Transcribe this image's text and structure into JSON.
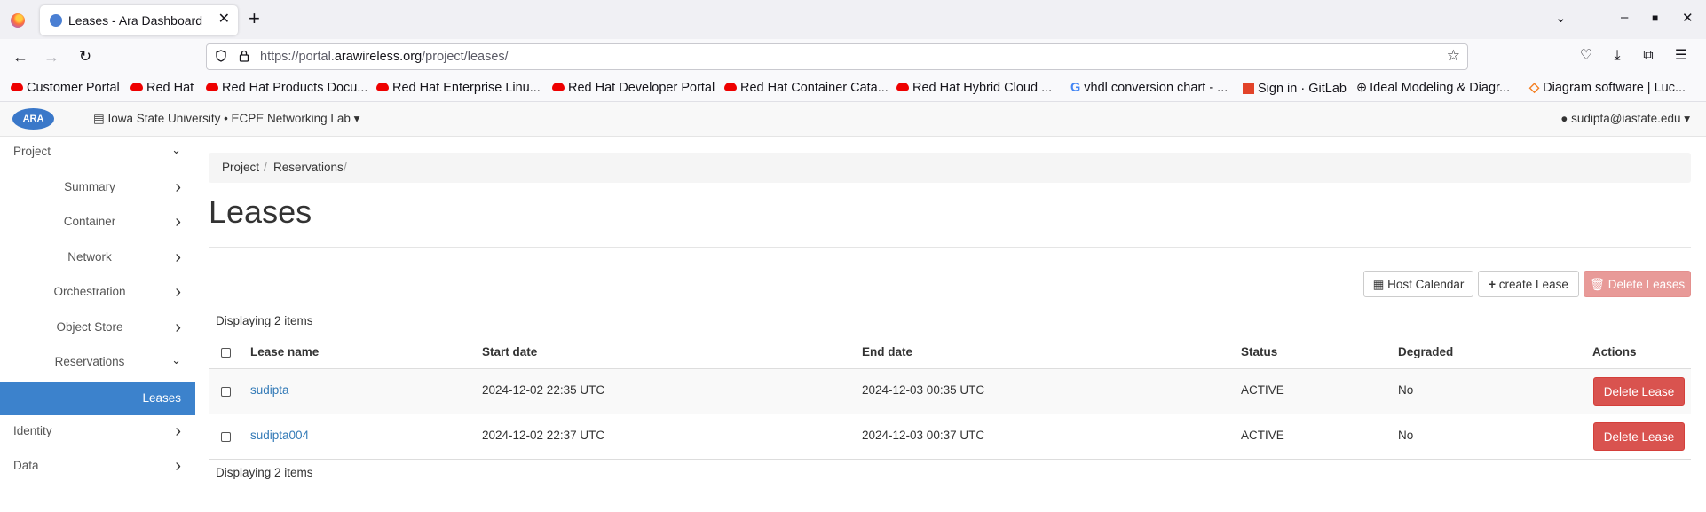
{
  "browser": {
    "tab_title": "Leases - Ara Dashboard",
    "tab_close": "✕",
    "new_tab": "+",
    "url_prefix": "https://portal.",
    "url_domain": "arawireless.org",
    "url_path": "/project/leases/",
    "bookmarks": [
      "Customer Portal",
      "Red Hat",
      "Red Hat Products Docu...",
      "Red Hat Enterprise Linu...",
      "Red Hat Developer Portal",
      "Red Hat Container Cata...",
      "Red Hat Hybrid Cloud ...",
      "vhdl conversion chart - ...",
      "Sign in · GitLab",
      "Ideal Modeling & Diagr...",
      "Diagram software | Luc..."
    ]
  },
  "header": {
    "logo": "ARA",
    "project_selector": "Iowa State University • ECPE Networking Lab ▾",
    "user": "sudipta@iastate.edu ▾"
  },
  "sidebar": {
    "items": [
      {
        "label": "Project",
        "chevron": "⌄"
      },
      {
        "label": "Summary",
        "chevron": "›"
      },
      {
        "label": "Container",
        "chevron": "›"
      },
      {
        "label": "Network",
        "chevron": "›"
      },
      {
        "label": "Orchestration",
        "chevron": "›"
      },
      {
        "label": "Object Store",
        "chevron": "›"
      },
      {
        "label": "Reservations",
        "chevron": "⌄"
      },
      {
        "label": "Leases",
        "chevron": ""
      },
      {
        "label": "Identity",
        "chevron": "›"
      },
      {
        "label": "Data",
        "chevron": "›"
      }
    ]
  },
  "breadcrumb": {
    "items": [
      "Project",
      "/",
      "Reservations",
      "/"
    ]
  },
  "page": {
    "title": "Leases",
    "host_calendar": "Host Calendar",
    "create_lease": "create Lease",
    "delete_leases": "Delete Leases",
    "count_top": "Displaying 2 items",
    "count_bottom": "Displaying 2 items"
  },
  "table": {
    "headers": [
      "Lease name",
      "Start date",
      "End date",
      "Status",
      "Degraded",
      "Actions"
    ],
    "rows": [
      {
        "name": "sudipta",
        "start": "2024-12-02 22:35 UTC",
        "end": "2024-12-03 00:35 UTC",
        "status": "ACTIVE",
        "degraded": "No",
        "action": "Delete Lease"
      },
      {
        "name": "sudipta004",
        "start": "2024-12-02 22:37 UTC",
        "end": "2024-12-03 00:37 UTC",
        "status": "ACTIVE",
        "degraded": "No",
        "action": "Delete Lease"
      }
    ]
  },
  "icons": {
    "calendar": "calendar-icon",
    "plus": "plus-icon",
    "trash": "trash-icon",
    "user": "user-icon"
  }
}
